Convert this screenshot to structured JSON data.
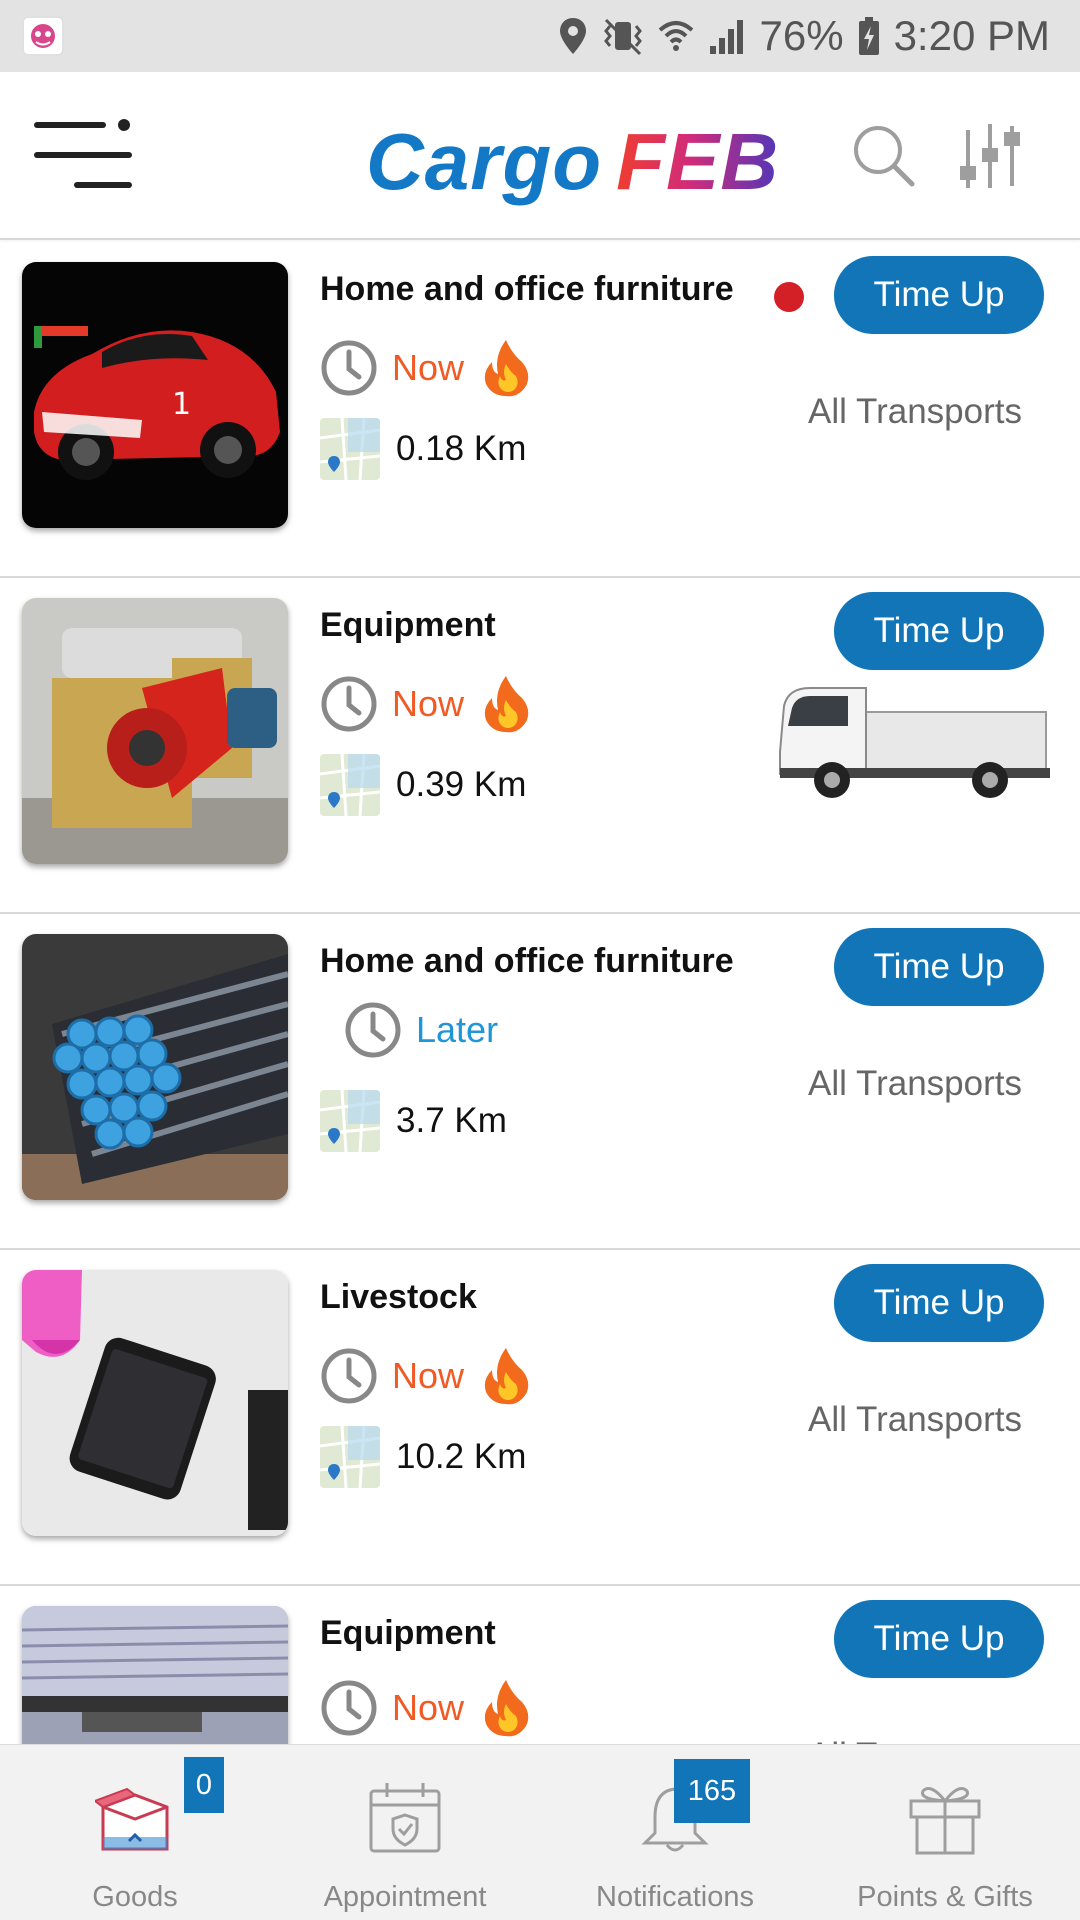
{
  "status_bar": {
    "battery": "76%",
    "time": "3:20 PM",
    "icons": [
      "location-icon",
      "vibrate-icon",
      "wifi-icon",
      "signal-icon",
      "battery-icon"
    ]
  },
  "header": {
    "logo_part1": "Cargo",
    "logo_part2": "FEB",
    "icons": [
      "menu-icon",
      "search-icon",
      "filter-icon"
    ]
  },
  "colors": {
    "accent": "#1275b7",
    "now": "#f05a24",
    "later": "#1f96d8",
    "new_dot": "#d32027"
  },
  "listings": [
    {
      "title": "Home and office furniture",
      "time": "Now",
      "urgent": true,
      "distance": "0.18 Km",
      "button": "Time Up",
      "transport": "All Transports",
      "new_dot": true,
      "thumb": "red-sports-car"
    },
    {
      "title": "Equipment",
      "time": "Now",
      "urgent": true,
      "distance": "0.39 Km",
      "button": "Time Up",
      "transport": "",
      "transport_icon": "truck-icon",
      "thumb": "industrial-machine"
    },
    {
      "title": "Home and office furniture",
      "time": "Later",
      "urgent": false,
      "distance": "3.7 Km",
      "button": "Time Up",
      "transport": "All Transports",
      "thumb": "steel-pipes"
    },
    {
      "title": "Livestock",
      "time": "Now",
      "urgent": true,
      "distance": "10.2 Km",
      "button": "Time Up",
      "transport": "All Transports",
      "thumb": "phone-on-table"
    },
    {
      "title": "Equipment",
      "time": "Now",
      "urgent": true,
      "distance": "",
      "button": "Time Up",
      "transport": "All Transports",
      "thumb": "monitor-screen"
    }
  ],
  "bottom_nav": [
    {
      "label": "Goods",
      "badge": "0",
      "icon": "box-icon",
      "active": true
    },
    {
      "label": "Appointment",
      "badge": "",
      "icon": "calendar-icon"
    },
    {
      "label": "Notifications",
      "badge": "165",
      "icon": "bell-icon"
    },
    {
      "label": "Points & Gifts",
      "badge": "",
      "icon": "gift-icon"
    }
  ]
}
